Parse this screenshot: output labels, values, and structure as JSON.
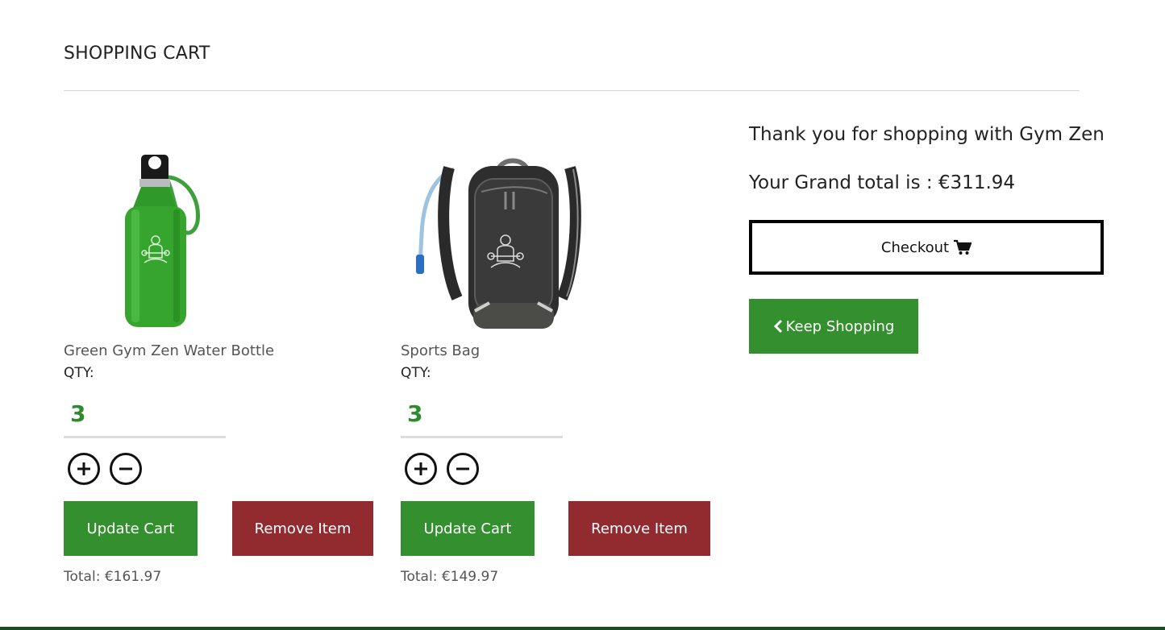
{
  "page": {
    "title": "SHOPPING CART"
  },
  "cart": {
    "items": [
      {
        "name": "Green Gym Zen Water Bottle",
        "qty_label": "QTY:",
        "qty": "3",
        "update_label": "Update Cart",
        "remove_label": "Remove Item",
        "total": "Total: €161.97",
        "image_icon": "water-bottle-image"
      },
      {
        "name": "Sports Bag",
        "qty_label": "QTY:",
        "qty": "3",
        "update_label": "Update Cart",
        "remove_label": "Remove Item",
        "total": "Total: €149.97",
        "image_icon": "backpack-image"
      }
    ]
  },
  "summary": {
    "thanks": "Thank you for shopping with Gym Zen",
    "grand_total": "Your Grand total is : €311.94",
    "checkout_label": "Checkout",
    "checkout_icon": "shopping-cart-icon",
    "keep_shopping_label": "Keep Shopping",
    "keep_shopping_icon": "chevron-left-icon"
  },
  "colors": {
    "primary_green": "#348f2f",
    "remove_red": "#922b2f",
    "qty_green": "#2f8a2f",
    "footer": "#1f4a28"
  }
}
